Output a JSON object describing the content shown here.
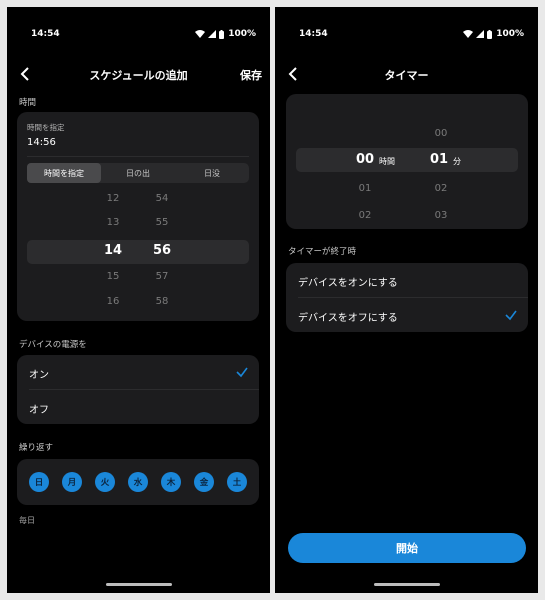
{
  "status": {
    "time": "14:54",
    "battery": "100%"
  },
  "left": {
    "title": "スケジュールの追加",
    "save_label": "保存",
    "time_section": "時間",
    "specify_label": "時間を指定",
    "time_value": "14:56",
    "segments": [
      "時間を指定",
      "日の出",
      "日没"
    ],
    "hours": [
      "12",
      "13",
      "14",
      "15",
      "16"
    ],
    "minutes": [
      "54",
      "55",
      "56",
      "57",
      "58"
    ],
    "power_section": "デバイスの電源を",
    "power_options": [
      "オン",
      "オフ"
    ],
    "repeat_section": "繰り返す",
    "days": [
      "日",
      "月",
      "火",
      "水",
      "木",
      "金",
      "土"
    ],
    "repeat_note": "毎日"
  },
  "right": {
    "title": "タイマー",
    "hours": [
      "00",
      "01",
      "02"
    ],
    "minutes": [
      "00",
      "01",
      "02",
      "03"
    ],
    "hour_unit": "時間",
    "minute_unit": "分",
    "end_section": "タイマーが終了時",
    "end_options": [
      "デバイスをオンにする",
      "デバイスをオフにする"
    ],
    "start_label": "開始"
  },
  "colors": {
    "accent": "#1a87d9",
    "card": "#1c1c1e",
    "background": "#000000"
  }
}
